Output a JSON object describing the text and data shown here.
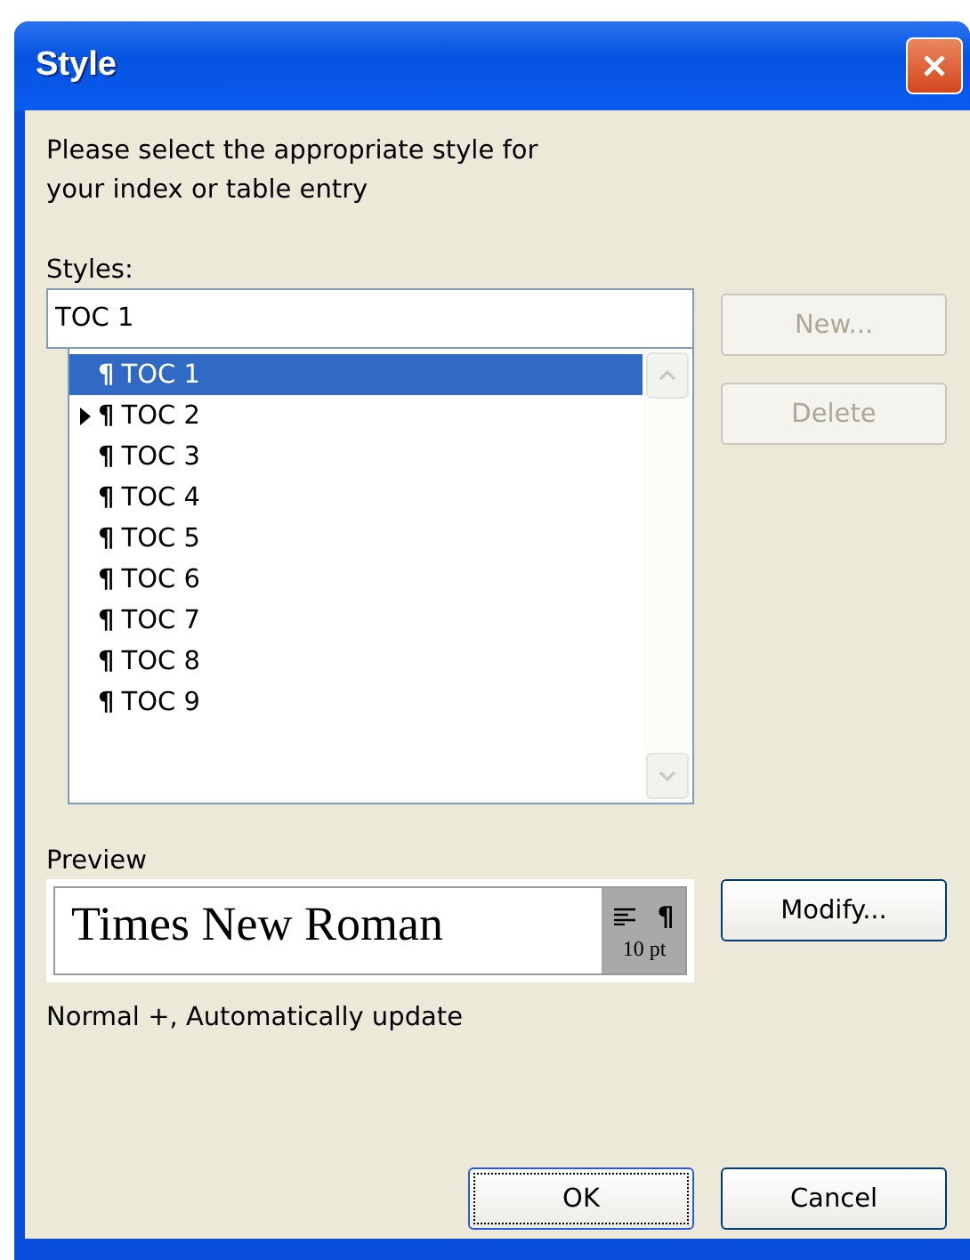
{
  "window": {
    "title": "Style"
  },
  "instructions": "Please select the appropriate style for your index or table entry",
  "styles_label": "Styles:",
  "style_field": {
    "value": "TOC 1"
  },
  "styles": [
    {
      "mark": "¶",
      "label": "TOC 1",
      "selected": true,
      "current": false
    },
    {
      "mark": "¶",
      "label": "TOC 2",
      "selected": false,
      "current": true
    },
    {
      "mark": "¶",
      "label": "TOC 3",
      "selected": false,
      "current": false
    },
    {
      "mark": "¶",
      "label": "TOC 4",
      "selected": false,
      "current": false
    },
    {
      "mark": "¶",
      "label": "TOC 5",
      "selected": false,
      "current": false
    },
    {
      "mark": "¶",
      "label": "TOC 6",
      "selected": false,
      "current": false
    },
    {
      "mark": "¶",
      "label": "TOC 7",
      "selected": false,
      "current": false
    },
    {
      "mark": "¶",
      "label": "TOC 8",
      "selected": false,
      "current": false
    },
    {
      "mark": "¶",
      "label": "TOC 9",
      "selected": false,
      "current": false
    }
  ],
  "side_buttons": [
    {
      "label": "New...",
      "disabled": true
    },
    {
      "label": "Delete",
      "disabled": true
    }
  ],
  "preview": {
    "label": "Preview",
    "sample": "Times New Roman",
    "paragraph_mark": "¶",
    "size": "10 pt"
  },
  "modify_button": {
    "label": "Modify...",
    "disabled": false
  },
  "description": "Normal +, Automatically update",
  "buttons": [
    {
      "label": "OK",
      "default": true
    },
    {
      "label": "Cancel",
      "default": false
    }
  ]
}
